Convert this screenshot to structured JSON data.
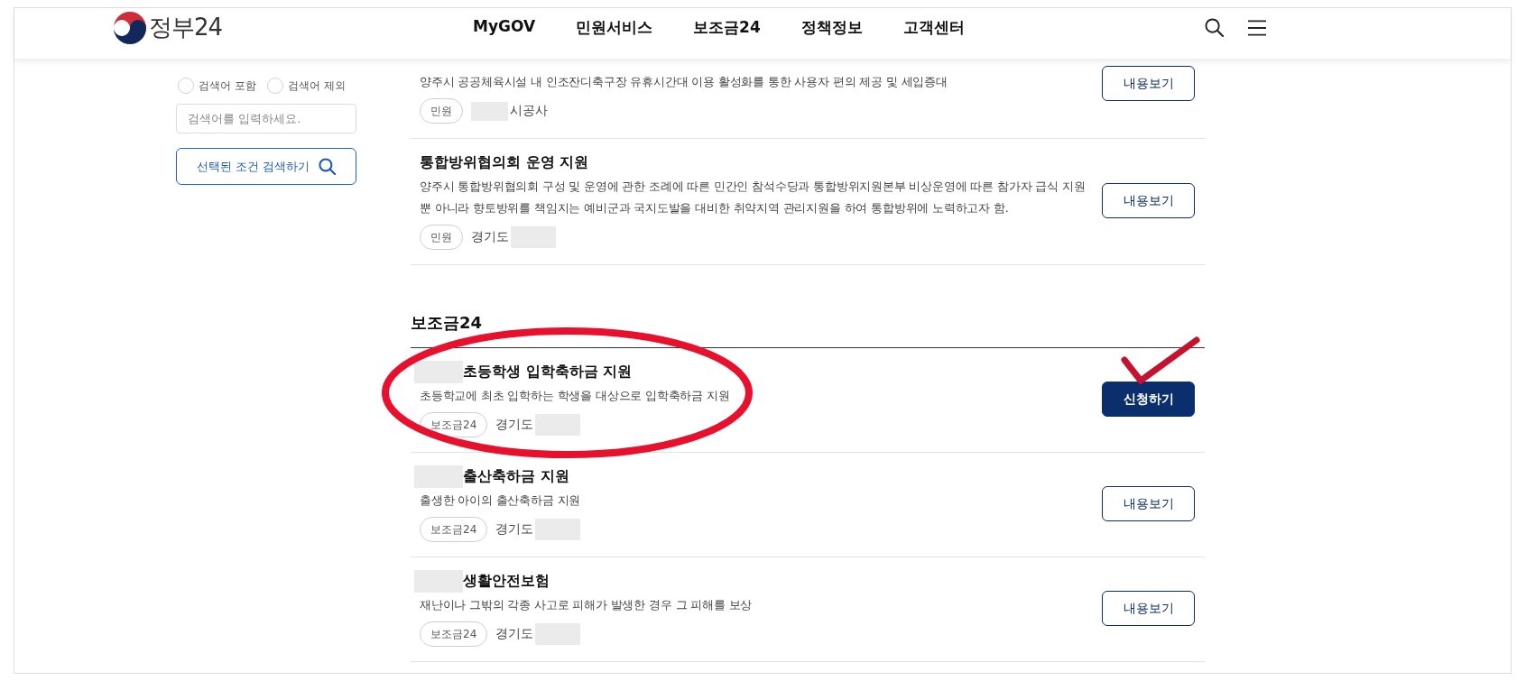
{
  "header": {
    "logo_text": "정부24",
    "nav": [
      {
        "label": "MyGOV"
      },
      {
        "label": "민원서비스"
      },
      {
        "label": "보조금24"
      },
      {
        "label": "정책정보"
      },
      {
        "label": "고객센터"
      }
    ]
  },
  "sidebar": {
    "search_options": [
      {
        "label": "검색어 포함",
        "selected": false
      },
      {
        "label": "검색어 제외",
        "selected": false
      }
    ],
    "search_field": {
      "placeholder": "검색어를 입력하세요."
    },
    "search_button": {
      "label": "선택된 조건 검색하기"
    }
  },
  "sections": [
    {
      "items": [
        {
          "description": "양주시 공공체육시설 내 인조잔디축구장 유휴시간대 이용 활성화를 통한 사용자 편의 제공 및 세입증대",
          "tag": "민원",
          "meta_parts": [
            {
              "kind": "redacted"
            },
            {
              "kind": "text",
              "text": "시공사"
            }
          ],
          "button": {
            "label": "내용보기",
            "kind": "outline",
            "check_marked": false
          },
          "circled": false
        },
        {
          "title_parts": [
            {
              "kind": "text",
              "text": "통합방위협의회 운영 지원"
            }
          ],
          "description": "양주시 통합방위협의회 구성 및 운영에 관한 조례에 따른 민간인 참석수당과 통합방위지원본부 비상운영에 따른 참가자 급식 지원 뿐 아니라 향토방위를 책임지는 예비군과 국지도발을 대비한 취약지역 관리지원을 하여 통합방위에 노력하고자 함.",
          "tag": "민원",
          "meta_parts": [
            {
              "kind": "text",
              "text": "경기도"
            },
            {
              "kind": "redacted"
            }
          ],
          "button": {
            "label": "내용보기",
            "kind": "outline",
            "check_marked": false
          },
          "circled": false
        }
      ]
    },
    {
      "heading": "보조금24",
      "items": [
        {
          "title_parts": [
            {
              "kind": "redacted"
            },
            {
              "kind": "text",
              "text": "초등학생 입학축하금 지원"
            }
          ],
          "description": "초등학교에 최초 입학하는 학생을 대상으로 입학축하금 지원",
          "tag": "보조금24",
          "meta_parts": [
            {
              "kind": "text",
              "text": "경기도"
            },
            {
              "kind": "redacted"
            }
          ],
          "button": {
            "label": "신청하기",
            "kind": "primary",
            "check_marked": true
          },
          "circled": true
        },
        {
          "title_parts": [
            {
              "kind": "redacted"
            },
            {
              "kind": "text",
              "text": "출산축하금 지원"
            }
          ],
          "description": "출생한 아이의 출산축하금 지원",
          "tag": "보조금24",
          "meta_parts": [
            {
              "kind": "text",
              "text": "경기도"
            },
            {
              "kind": "redacted"
            }
          ],
          "button": {
            "label": "내용보기",
            "kind": "outline",
            "check_marked": false
          },
          "circled": false
        },
        {
          "title_parts": [
            {
              "kind": "redacted"
            },
            {
              "kind": "text",
              "text": "생활안전보험"
            }
          ],
          "description": "재난이나 그밖의 각종 사고로 피해가 발생한 경우 그 피해를 보상",
          "tag": "보조금24",
          "meta_parts": [
            {
              "kind": "text",
              "text": "경기도"
            },
            {
              "kind": "redacted"
            }
          ],
          "button": {
            "label": "내용보기",
            "kind": "outline",
            "check_marked": false
          },
          "circled": false
        }
      ]
    }
  ]
}
